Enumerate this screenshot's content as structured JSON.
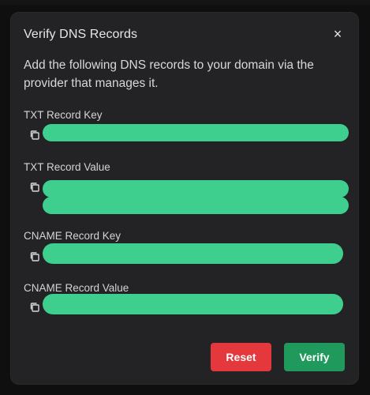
{
  "dialog": {
    "title": "Verify DNS Records",
    "close_glyph": "×",
    "description": "Add the following DNS records to your domain via the provider that manages it."
  },
  "records": [
    {
      "label": "TXT Record Key"
    },
    {
      "label": "TXT Record Value"
    },
    {
      "label": "CNAME Record Key"
    },
    {
      "label": "CNAME Record Value"
    }
  ],
  "actions": {
    "reset_label": "Reset",
    "verify_label": "Verify"
  },
  "colors": {
    "accent_green": "#3ecf8e",
    "reset_red": "#e5383d",
    "verify_green": "#1f9a5c"
  },
  "icons": {
    "close": "close-icon",
    "copy": "copy-icon"
  }
}
